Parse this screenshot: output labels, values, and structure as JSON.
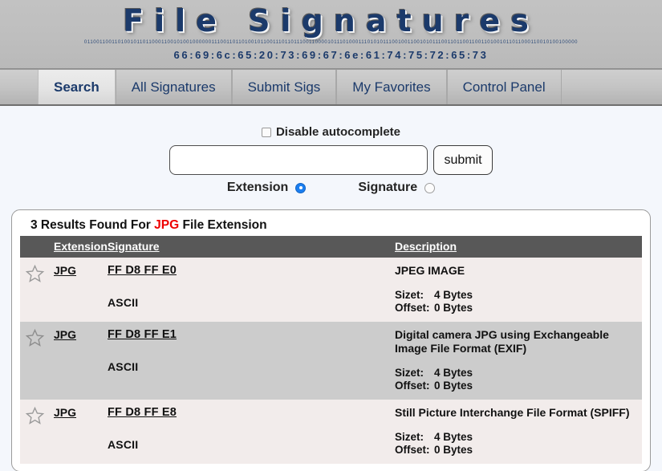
{
  "banner": {
    "title": "File Signatures",
    "binary_strip": "0110011001101001011011000110010100100000011100110110100101100111011011100110000101110100011101010111001001100101011100110110011001101001011011000110010100100000",
    "hex_string": "66:69:6c:65:20:73:69:67:6e:61:74:75:72:65:73",
    "title_color": "#1b3a6b"
  },
  "tabs": [
    {
      "label": "Search",
      "active": true
    },
    {
      "label": "All Signatures",
      "active": false
    },
    {
      "label": "Submit Sigs",
      "active": false
    },
    {
      "label": "My Favorites",
      "active": false
    },
    {
      "label": "Control Panel",
      "active": false
    }
  ],
  "search": {
    "autocomplete_label": "Disable autocomplete",
    "autocomplete_checked": false,
    "input_value": "",
    "input_placeholder": "",
    "submit_label": "submit",
    "mode_extension_label": "Extension",
    "mode_signature_label": "Signature",
    "mode_selected": "Extension"
  },
  "results": {
    "title_prefix": "3 Results Found For",
    "title_highlight": "JPG",
    "title_suffix": "File Extension",
    "highlight_color": "#ee0000",
    "columns": {
      "star": "",
      "extension": "Extension",
      "signature": "Signature",
      "description": "Description"
    },
    "rows": [
      {
        "favorite": false,
        "extension": "JPG",
        "signature": "FF D8 FF E0",
        "ascii": "ASCII",
        "description": "JPEG IMAGE",
        "size_label": "Sizet:",
        "size_value": "4 Bytes",
        "offset_label": "Offset:",
        "offset_value": "0 Bytes"
      },
      {
        "favorite": false,
        "extension": "JPG",
        "signature": "FF D8 FF E1",
        "ascii": "ASCII",
        "description": "Digital camera JPG using Exchangeable Image File Format (EXIF)",
        "size_label": "Sizet:",
        "size_value": "4 Bytes",
        "offset_label": "Offset:",
        "offset_value": "0 Bytes"
      },
      {
        "favorite": false,
        "extension": "JPG",
        "signature": "FF D8 FF E8",
        "ascii": "ASCII",
        "description": "Still Picture Interchange File Format (SPIFF)",
        "size_label": "Sizet:",
        "size_value": "4 Bytes",
        "offset_label": "Offset:",
        "offset_value": "0 Bytes"
      }
    ]
  }
}
